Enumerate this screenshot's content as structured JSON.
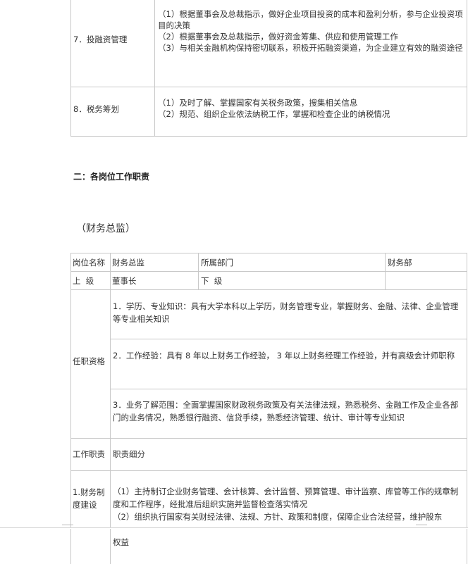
{
  "top_table": {
    "row7": {
      "label": "7．投融资管理",
      "lines": [
        "（1）根据董事会及总裁指示，做好企业项目投资的成本和盈利分析，参与企业投资项目的决策",
        "（2）根据董事会及总裁指示，做好资金筹集、供应和使用管理工作",
        "（3）与相关金融机构保持密切联系，积极开拓融资渠道，为企业建立有效的融资途径"
      ]
    },
    "row8": {
      "label": "8．税务筹划",
      "lines": [
        "（1）及时了解、掌握国家有关税务政策，搜集相关信息",
        "（2）规范、组织企业依法纳税工作，掌握和检查企业的纳税情况"
      ]
    }
  },
  "section_heading": "二：各岗位工作职责",
  "position_heading": "（财务总监）",
  "job_table": {
    "post_name_label": "岗位名称",
    "post_name_value": "财务总监",
    "dept_label": "所属部门",
    "dept_value": "财务部",
    "superior_label": "上  级",
    "superior_value": "董事长",
    "subordinate_label": "下  级",
    "subordinate_value": "",
    "qualification_label": "任职资格",
    "qualifications": [
      "1．学历、专业知识：具有大学本科以上学历，财务管理专业，掌握财务、金融、法律、企业管理等专业相关知识",
      "2．工作经验：具有 8 年以上财务工作经验， 3 年以上财务经理工作经验，并有高级会计师职称",
      "3．业务了解范围：全面掌握国家财政税务政策及有关法律法规，熟悉税务、金融工作及企业各部门的业务情况，熟悉银行融资、信贷手续，熟悉经济管理、统计、审计等专业知识"
    ],
    "duty_label": "工作职责",
    "duty_detail_label": "职责细分",
    "duty1_label": "1.财务制度建设",
    "duty1_lines": [
      "（1）主持制订企业财务管理、会计核算、会计监督、预算管理、审计监察、库管等工作的规章制度和工作程序，经批准后组织实施并监督检查落实情况",
      "（2）组织执行国家有关财经法律、法规、方针、政策和制度，保障企业合法经营，维护股东"
    ],
    "continuation": "权益"
  }
}
